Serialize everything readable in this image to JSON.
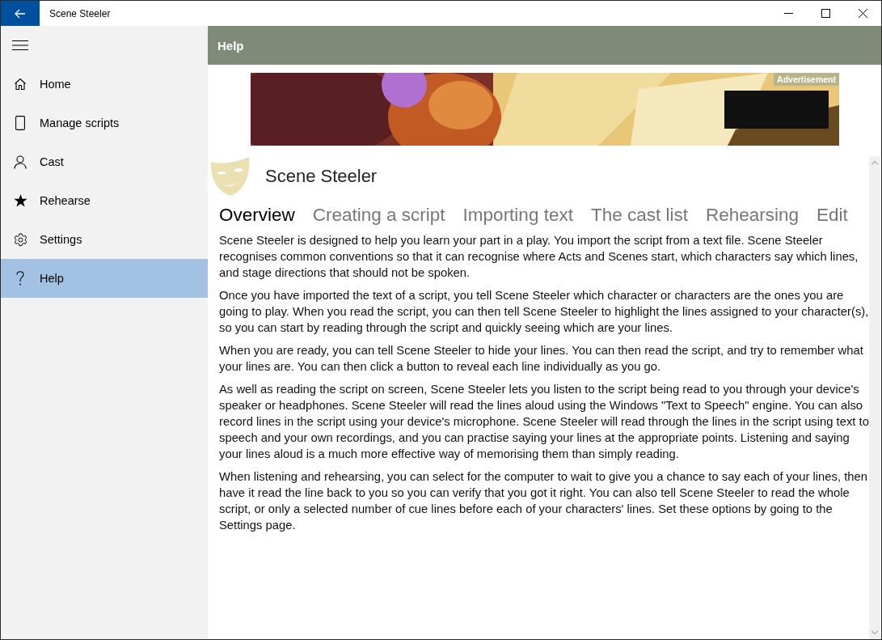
{
  "window": {
    "title": "Scene Steeler"
  },
  "sidebar": {
    "items": [
      {
        "label": "Home",
        "selected": false
      },
      {
        "label": "Manage scripts",
        "selected": false
      },
      {
        "label": "Cast",
        "selected": false
      },
      {
        "label": "Rehearse",
        "selected": false
      },
      {
        "label": "Settings",
        "selected": false
      },
      {
        "label": "Help",
        "selected": true
      }
    ]
  },
  "header": {
    "title": "Help"
  },
  "advertisement": {
    "kind": "picture",
    "label": "Advertisement"
  },
  "app_title": "Scene Steeler",
  "tabs": [
    {
      "label": "Overview",
      "selected": true
    },
    {
      "label": "Creating a script",
      "selected": false
    },
    {
      "label": "Importing text",
      "selected": false
    },
    {
      "label": "The cast list",
      "selected": false
    },
    {
      "label": "Rehearsing",
      "selected": false
    },
    {
      "label": "Edit",
      "selected": false
    }
  ],
  "paragraphs": [
    "Scene Steeler is designed to help you learn your part in a play. You import the script from a text file. Scene Steeler recognises common conventions so that it can recognise where Acts and Scenes start, which characters say which lines, and stage directions that should not be spoken.",
    "Once you have imported the text of a script, you tell Scene Steeler which character or characters are the ones you are going to play. When you read the script, you can then tell Scene Steeler to highlight the lines assigned to your character(s), so you can start by reading through the script and quickly seeing which are your lines.",
    "When you are ready, you can tell Scene Steeler to hide your lines. You can then read the script, and try to remember what your lines are. You can then click a button to reveal each line individually as you go.",
    "As well as reading the script on screen, Scene Steeler lets you listen to the script being read to you through your device's speaker or headphones. Scene Steeler will read the lines aloud using the Windows \"Text to Speech\" engine. You can also record lines in the script using your device's microphone. Scene Steeler will read through the lines in the script using text to speech and your own recordings, and you can practise saying your lines at the appropriate points. Listening and saying your lines aloud is a much more effective way of memorising them than simply reading.",
    "When listening and rehearsing, you can select for the computer to wait to give you a chance to say each of your lines, then have it read the line back to you so you can verify that you got it right. You can also tell Scene Steeler to read the whole script, or only a selected number of cue lines before each of your characters' lines. Set these options by going to the Settings page."
  ]
}
